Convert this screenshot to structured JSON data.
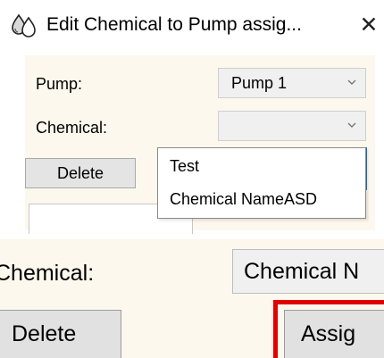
{
  "dialog": {
    "title": "Edit Chemical to Pump assig...",
    "title_icon": "chemical-drops-icon",
    "close_glyph": "✕",
    "pump_label": "Pump:",
    "pump_value": "Pump 1",
    "chemical_label": "Chemical:",
    "chemical_value": "",
    "delete_label": "Delete",
    "dropdown_options": [
      "Test",
      "Chemical NameASD"
    ]
  },
  "zoom": {
    "chemical_label": "Chemical:",
    "chemical_value": "Chemical N",
    "delete_label": "Delete",
    "assign_label": "Assig"
  },
  "colors": {
    "dialog_background": "#fdf8ee",
    "combo_background": "#f0f0f0",
    "button_background": "#e4e4e4",
    "highlight": "#e00000",
    "focus_accent": "#1679d0"
  }
}
